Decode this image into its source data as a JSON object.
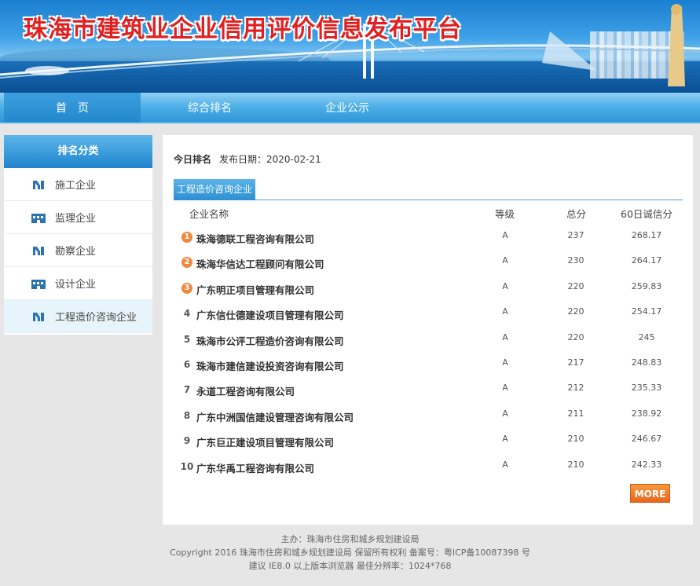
{
  "banner": {
    "title": "珠海市建筑业企业信用评价信息发布平台"
  },
  "nav": {
    "items": [
      "首　页",
      "综合排名",
      "企业公示"
    ]
  },
  "sidebar": {
    "title": "排名分类",
    "items": [
      {
        "label": "施工企业",
        "icon": "crane-icon"
      },
      {
        "label": "监理企业",
        "icon": "building-icon"
      },
      {
        "label": "勘察企业",
        "icon": "crane-icon"
      },
      {
        "label": "设计企业",
        "icon": "building-icon"
      },
      {
        "label": "工程造价咨询企业",
        "icon": "crane-icon"
      }
    ]
  },
  "main": {
    "today_label": "今日排名",
    "date_label": "发布日期：2020-02-21",
    "tab": "工程造价咨询企业",
    "columns": [
      "企业名称",
      "等级",
      "总分",
      "60日诚信分"
    ],
    "rows": [
      {
        "rank": "1",
        "name": "珠海德联工程咨询有限公司",
        "grade": "A",
        "total": "237",
        "score60": "268.17"
      },
      {
        "rank": "2",
        "name": "珠海华信达工程顾问有限公司",
        "grade": "A",
        "total": "230",
        "score60": "264.17"
      },
      {
        "rank": "3",
        "name": "广东明正项目管理有限公司",
        "grade": "A",
        "total": "220",
        "score60": "259.83"
      },
      {
        "rank": "4",
        "name": "广东信仕德建设项目管理有限公司",
        "grade": "A",
        "total": "220",
        "score60": "254.17"
      },
      {
        "rank": "5",
        "name": "珠海市公评工程造价咨询有限公司",
        "grade": "A",
        "total": "220",
        "score60": "245"
      },
      {
        "rank": "6",
        "name": "珠海市建信建设投资咨询有限公司",
        "grade": "A",
        "total": "217",
        "score60": "248.83"
      },
      {
        "rank": "7",
        "name": "永道工程咨询有限公司",
        "grade": "A",
        "total": "212",
        "score60": "235.33"
      },
      {
        "rank": "8",
        "name": "广东中洲国信建设管理咨询有限公司",
        "grade": "A",
        "total": "211",
        "score60": "238.92"
      },
      {
        "rank": "9",
        "name": "广东巨正建设项目管理有限公司",
        "grade": "A",
        "total": "210",
        "score60": "246.67"
      },
      {
        "rank": "10",
        "name": "广东华禹工程咨询有限公司",
        "grade": "A",
        "total": "210",
        "score60": "242.33"
      }
    ],
    "more": "MORE"
  },
  "footer": {
    "line1": "主办：珠海市住房和城乡规划建设局",
    "line2": "Copyright 2016 珠海市住房和城乡规划建设局 保留所有权利 备案号：粤ICP备10087398 号",
    "line3": "建议 IE8.0 以上版本浏览器 最佳分辨率：1024*768"
  },
  "colors": {
    "title_red": "#e02020",
    "nav_blue": "#2f95d6",
    "rank_badge": "#f0883d",
    "more_orange": "#e8661d"
  }
}
